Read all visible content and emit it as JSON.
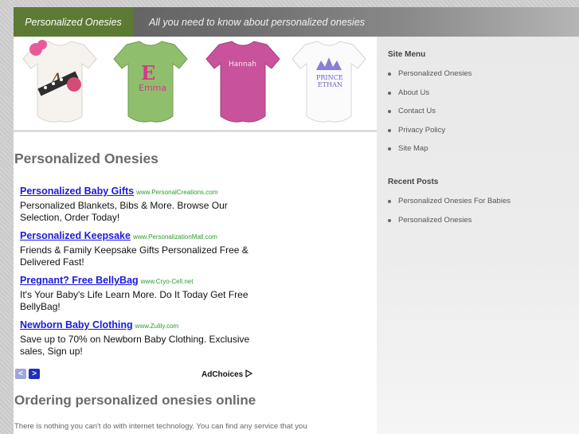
{
  "header": {
    "brand": "Personalized Onesies",
    "tagline": "All you need to know about personalized onesies"
  },
  "banner": {
    "onesie_texts": [
      "A",
      "E",
      "Emma",
      "Hannah",
      "PRINCE",
      "ETHAN"
    ]
  },
  "sidebar": {
    "site_menu_heading": "Site Menu",
    "site_menu": [
      "Personalized Onesies",
      "About Us",
      "Contact Us",
      "Privacy Policy",
      "Site Map"
    ],
    "recent_posts_heading": "Recent Posts",
    "recent_posts": [
      "Personalized Onesies For Babies",
      "Personalized Onesies"
    ]
  },
  "main": {
    "title": "Personalized Onesies",
    "ads": [
      {
        "title": "Personalized Baby Gifts",
        "url": "www.PersonalCreations.com",
        "desc": "Personalized Blankets, Bibs & More. Browse Our Selection, Order Today!"
      },
      {
        "title": "Personalized Keepsake",
        "url": "www.PersonalizationMall.com",
        "desc": "Friends & Family Keepsake Gifts Personalized Free & Delivered Fast!"
      },
      {
        "title": "Pregnant? Free BellyBag",
        "url": "www.Cryo-Cell.net",
        "desc": "It's Your Baby's Life Learn More. Do It Today Get Free BellyBag!"
      },
      {
        "title": "Newborn Baby Clothing",
        "url": "www.Zulily.com",
        "desc": "Save up to 70% on Newborn Baby Clothing. Exclusive sales, Sign up!"
      }
    ],
    "ad_nav": {
      "prev": "<",
      "next": ">"
    },
    "adchoices_label": "AdChoices",
    "subtitle": "Ordering personalized onesies online",
    "paragraph": "There is nothing you can't do with internet technology. You can find any service that you"
  },
  "colors": {
    "brand_bg": "#5d7a35",
    "ad_link": "#1a1ae0",
    "ad_url": "#2d9b2d",
    "heading": "#6b6b6b"
  }
}
